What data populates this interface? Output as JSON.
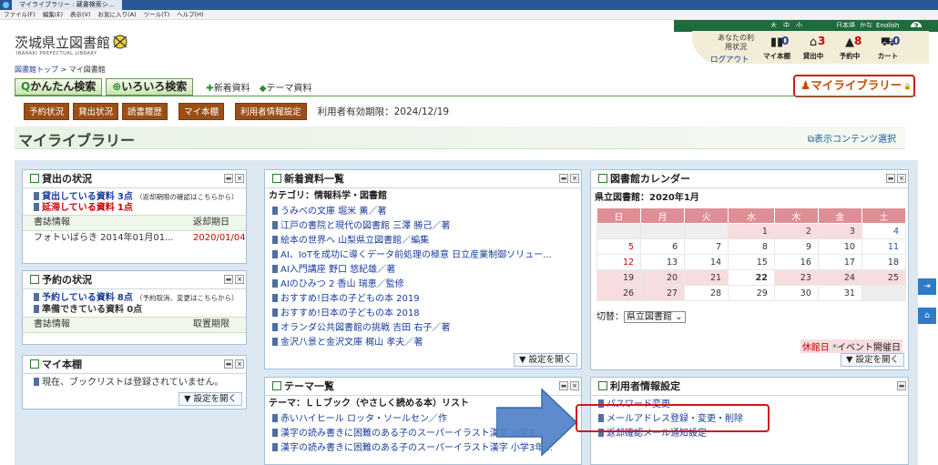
{
  "browser": {
    "tab_title": "マイライブラリー : 蔵書検索シ…",
    "menu": [
      "ファイル(F)",
      "編集(E)",
      "表示(V)",
      "お気に入り(A)",
      "ツール(T)",
      "ヘルプ(H)"
    ]
  },
  "topbar": {
    "text_sizes": [
      "大",
      "中",
      "小"
    ],
    "lang": [
      "日本語",
      "かな",
      "English"
    ],
    "help_icon_label": "?"
  },
  "header": {
    "logo_text": "茨城県立図書館",
    "logo_sub": "IBARAKI PREFECTUAL LIBRARY",
    "user_status_label": "あなたの利用状況",
    "logout": "ログアウト",
    "counters": [
      {
        "label": "マイ本棚",
        "count": "0",
        "icon": "bookshelf-icon"
      },
      {
        "label": "貸出中",
        "count": "3",
        "icon": "house-icon"
      },
      {
        "label": "予約中",
        "count": "8",
        "icon": "cart-reserve-icon"
      },
      {
        "label": "カート",
        "count": "0",
        "icon": "cart-icon"
      }
    ]
  },
  "breadcrumb": {
    "home": "図書館トップ",
    "separator": ">",
    "current": "マイ図書館"
  },
  "search_tabs": {
    "simple": "かんたん検索",
    "advanced": "いろいろ検索",
    "new_items": "新着資料",
    "theme_items": "テーマ資料"
  },
  "mylibrary_button": "マイライブラリー",
  "action_buttons": [
    "予約状況",
    "貸出状況",
    "読書履歴",
    "マイ本棚",
    "利用者情報設定"
  ],
  "expiry": "利用者有効期限：2024/12/19",
  "page_title": "マイライブラリー",
  "content_select": "表示コンテンツ選択",
  "panels": {
    "loan": {
      "title": "貸出の状況",
      "loaned_label": "貸出している資料",
      "loaned_count": "3点",
      "loaned_note": "（返却期限の確認はこちらから）",
      "overdue_label": "延滞している資料",
      "overdue_count": "1点",
      "col_book": "書誌情報",
      "col_due": "返却期日",
      "rows": [
        {
          "book": "フォトいばらき 2014年01月01...",
          "due": "2020/01/04"
        }
      ]
    },
    "reserve": {
      "title": "予約の状況",
      "reserved_label": "予約している資料",
      "reserved_count": "8点",
      "reserved_note": "（予約取消、変更はこちらから）",
      "ready_label": "準備できている資料",
      "ready_count": "0点",
      "col_book": "書誌情報",
      "col_deadline": "取置期限"
    },
    "shelf": {
      "title": "マイ本棚",
      "empty_text": "現在、ブックリストは登録されていません。",
      "settings_button": "設定を開く"
    },
    "new_items": {
      "title": "新着資料一覧",
      "category": "カテゴリ：情報科学・図書館",
      "items": [
        "うみべの文庫 堀米 薫／著",
        "江戸の書院と現代の図書館 三澤 勝己／著",
        "絵本の世界へ 山梨県立図書館／編集",
        "AI、IoTを成功に導くデータ前処理の極意 日立産業制御ソリュー...",
        "AI入門講座 野口 悠紀雄／著",
        "AIのひみつ 2 香山 瑞恵／監修",
        "おすすめ!日本の子どもの本 2019",
        "おすすめ!日本の子どもの本 2018",
        "オランダ公共図書館の挑戦 吉田 右子／著",
        "金沢八景と金沢文庫 梶山 孝夫／著"
      ],
      "settings_button": "設定を開く"
    },
    "theme": {
      "title": "テーマ一覧",
      "theme_label": "テーマ：ＬＬブック（やさしく読める本）リスト",
      "items": [
        "赤いハイヒール ロッタ・ソールセン／作",
        "漢字の読み書きに困難のある子のスーパーイラスト漢字 小学2...",
        "漢字の読み書きに困難のある子のスーパーイラスト漢字 小学3年..."
      ]
    },
    "calendar": {
      "title": "図書館カレンダー",
      "heading": "県立図書館：2020年1月",
      "weekdays": [
        "日",
        "月",
        "火",
        "水",
        "木",
        "金",
        "土"
      ],
      "weeks": [
        [
          "",
          "",
          "",
          "1",
          "2",
          "3",
          "4"
        ],
        [
          "5",
          "6",
          "7",
          "8",
          "9",
          "10",
          "11"
        ],
        [
          "12",
          "13",
          "14",
          "15",
          "16",
          "17",
          "18"
        ],
        [
          "19",
          "20",
          "21",
          "22",
          "23",
          "24",
          "25"
        ],
        [
          "26",
          "27",
          "28",
          "29",
          "30",
          "31",
          ""
        ]
      ],
      "switch_label": "切替：",
      "switch_value": "県立図書館",
      "legend_closed": "休館日",
      "legend_event": "イベント開催日",
      "settings_button": "設定を開く"
    },
    "user_settings": {
      "title": "利用者情報設定",
      "items": [
        "パスワード変更",
        "メールアドレス登録・変更・削除",
        "返却確認メール通知設定"
      ]
    }
  }
}
